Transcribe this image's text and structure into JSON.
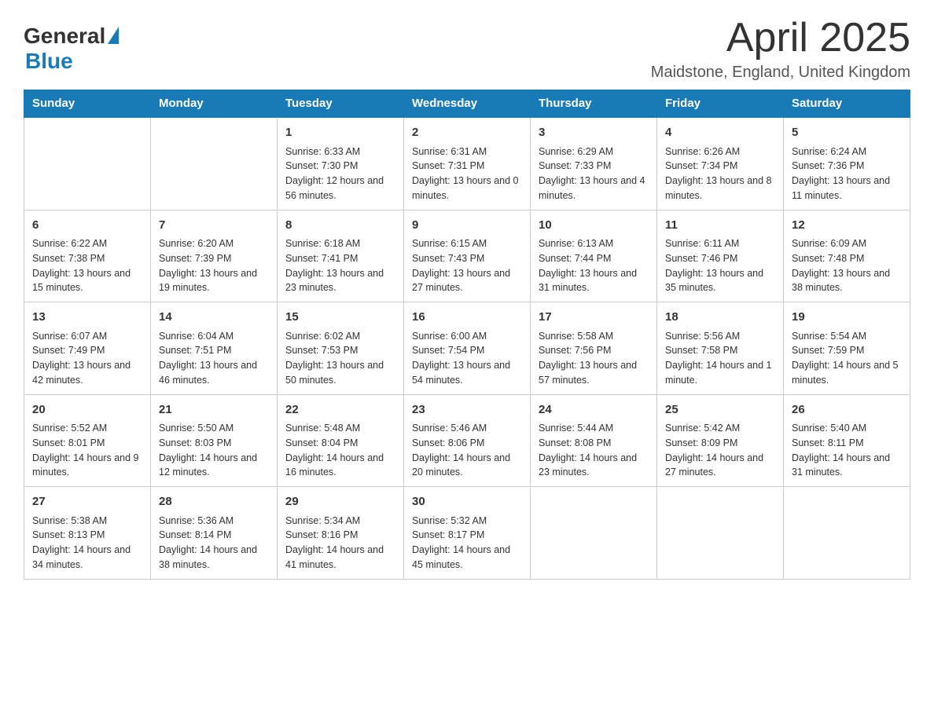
{
  "header": {
    "logo_general": "General",
    "logo_blue": "Blue",
    "month_title": "April 2025",
    "location": "Maidstone, England, United Kingdom"
  },
  "weekdays": [
    "Sunday",
    "Monday",
    "Tuesday",
    "Wednesday",
    "Thursday",
    "Friday",
    "Saturday"
  ],
  "weeks": [
    [
      {
        "day": "",
        "sunrise": "",
        "sunset": "",
        "daylight": ""
      },
      {
        "day": "",
        "sunrise": "",
        "sunset": "",
        "daylight": ""
      },
      {
        "day": "1",
        "sunrise": "Sunrise: 6:33 AM",
        "sunset": "Sunset: 7:30 PM",
        "daylight": "Daylight: 12 hours and 56 minutes."
      },
      {
        "day": "2",
        "sunrise": "Sunrise: 6:31 AM",
        "sunset": "Sunset: 7:31 PM",
        "daylight": "Daylight: 13 hours and 0 minutes."
      },
      {
        "day": "3",
        "sunrise": "Sunrise: 6:29 AM",
        "sunset": "Sunset: 7:33 PM",
        "daylight": "Daylight: 13 hours and 4 minutes."
      },
      {
        "day": "4",
        "sunrise": "Sunrise: 6:26 AM",
        "sunset": "Sunset: 7:34 PM",
        "daylight": "Daylight: 13 hours and 8 minutes."
      },
      {
        "day": "5",
        "sunrise": "Sunrise: 6:24 AM",
        "sunset": "Sunset: 7:36 PM",
        "daylight": "Daylight: 13 hours and 11 minutes."
      }
    ],
    [
      {
        "day": "6",
        "sunrise": "Sunrise: 6:22 AM",
        "sunset": "Sunset: 7:38 PM",
        "daylight": "Daylight: 13 hours and 15 minutes."
      },
      {
        "day": "7",
        "sunrise": "Sunrise: 6:20 AM",
        "sunset": "Sunset: 7:39 PM",
        "daylight": "Daylight: 13 hours and 19 minutes."
      },
      {
        "day": "8",
        "sunrise": "Sunrise: 6:18 AM",
        "sunset": "Sunset: 7:41 PM",
        "daylight": "Daylight: 13 hours and 23 minutes."
      },
      {
        "day": "9",
        "sunrise": "Sunrise: 6:15 AM",
        "sunset": "Sunset: 7:43 PM",
        "daylight": "Daylight: 13 hours and 27 minutes."
      },
      {
        "day": "10",
        "sunrise": "Sunrise: 6:13 AM",
        "sunset": "Sunset: 7:44 PM",
        "daylight": "Daylight: 13 hours and 31 minutes."
      },
      {
        "day": "11",
        "sunrise": "Sunrise: 6:11 AM",
        "sunset": "Sunset: 7:46 PM",
        "daylight": "Daylight: 13 hours and 35 minutes."
      },
      {
        "day": "12",
        "sunrise": "Sunrise: 6:09 AM",
        "sunset": "Sunset: 7:48 PM",
        "daylight": "Daylight: 13 hours and 38 minutes."
      }
    ],
    [
      {
        "day": "13",
        "sunrise": "Sunrise: 6:07 AM",
        "sunset": "Sunset: 7:49 PM",
        "daylight": "Daylight: 13 hours and 42 minutes."
      },
      {
        "day": "14",
        "sunrise": "Sunrise: 6:04 AM",
        "sunset": "Sunset: 7:51 PM",
        "daylight": "Daylight: 13 hours and 46 minutes."
      },
      {
        "day": "15",
        "sunrise": "Sunrise: 6:02 AM",
        "sunset": "Sunset: 7:53 PM",
        "daylight": "Daylight: 13 hours and 50 minutes."
      },
      {
        "day": "16",
        "sunrise": "Sunrise: 6:00 AM",
        "sunset": "Sunset: 7:54 PM",
        "daylight": "Daylight: 13 hours and 54 minutes."
      },
      {
        "day": "17",
        "sunrise": "Sunrise: 5:58 AM",
        "sunset": "Sunset: 7:56 PM",
        "daylight": "Daylight: 13 hours and 57 minutes."
      },
      {
        "day": "18",
        "sunrise": "Sunrise: 5:56 AM",
        "sunset": "Sunset: 7:58 PM",
        "daylight": "Daylight: 14 hours and 1 minute."
      },
      {
        "day": "19",
        "sunrise": "Sunrise: 5:54 AM",
        "sunset": "Sunset: 7:59 PM",
        "daylight": "Daylight: 14 hours and 5 minutes."
      }
    ],
    [
      {
        "day": "20",
        "sunrise": "Sunrise: 5:52 AM",
        "sunset": "Sunset: 8:01 PM",
        "daylight": "Daylight: 14 hours and 9 minutes."
      },
      {
        "day": "21",
        "sunrise": "Sunrise: 5:50 AM",
        "sunset": "Sunset: 8:03 PM",
        "daylight": "Daylight: 14 hours and 12 minutes."
      },
      {
        "day": "22",
        "sunrise": "Sunrise: 5:48 AM",
        "sunset": "Sunset: 8:04 PM",
        "daylight": "Daylight: 14 hours and 16 minutes."
      },
      {
        "day": "23",
        "sunrise": "Sunrise: 5:46 AM",
        "sunset": "Sunset: 8:06 PM",
        "daylight": "Daylight: 14 hours and 20 minutes."
      },
      {
        "day": "24",
        "sunrise": "Sunrise: 5:44 AM",
        "sunset": "Sunset: 8:08 PM",
        "daylight": "Daylight: 14 hours and 23 minutes."
      },
      {
        "day": "25",
        "sunrise": "Sunrise: 5:42 AM",
        "sunset": "Sunset: 8:09 PM",
        "daylight": "Daylight: 14 hours and 27 minutes."
      },
      {
        "day": "26",
        "sunrise": "Sunrise: 5:40 AM",
        "sunset": "Sunset: 8:11 PM",
        "daylight": "Daylight: 14 hours and 31 minutes."
      }
    ],
    [
      {
        "day": "27",
        "sunrise": "Sunrise: 5:38 AM",
        "sunset": "Sunset: 8:13 PM",
        "daylight": "Daylight: 14 hours and 34 minutes."
      },
      {
        "day": "28",
        "sunrise": "Sunrise: 5:36 AM",
        "sunset": "Sunset: 8:14 PM",
        "daylight": "Daylight: 14 hours and 38 minutes."
      },
      {
        "day": "29",
        "sunrise": "Sunrise: 5:34 AM",
        "sunset": "Sunset: 8:16 PM",
        "daylight": "Daylight: 14 hours and 41 minutes."
      },
      {
        "day": "30",
        "sunrise": "Sunrise: 5:32 AM",
        "sunset": "Sunset: 8:17 PM",
        "daylight": "Daylight: 14 hours and 45 minutes."
      },
      {
        "day": "",
        "sunrise": "",
        "sunset": "",
        "daylight": ""
      },
      {
        "day": "",
        "sunrise": "",
        "sunset": "",
        "daylight": ""
      },
      {
        "day": "",
        "sunrise": "",
        "sunset": "",
        "daylight": ""
      }
    ]
  ]
}
